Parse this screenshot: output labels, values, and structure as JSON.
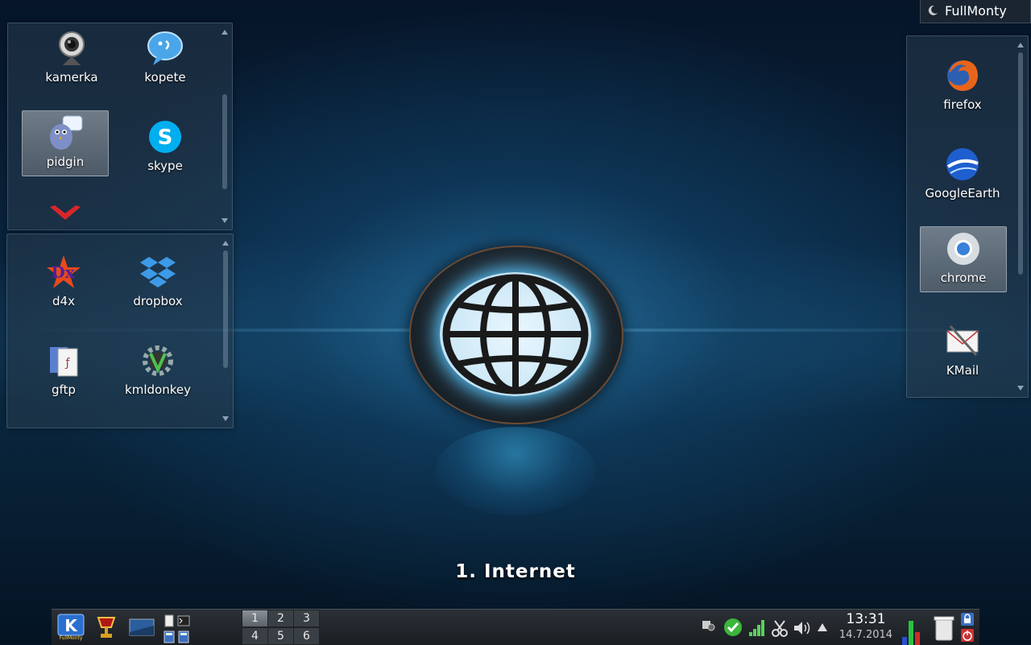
{
  "activity": {
    "name": "FullMonty"
  },
  "desktop": {
    "title": "1. Internet"
  },
  "folders": {
    "top_left": {
      "apps": [
        {
          "label": "kamerka",
          "icon": "webcam-icon"
        },
        {
          "label": "kopete",
          "icon": "kopete-icon"
        },
        {
          "label": "pidgin",
          "icon": "pidgin-icon",
          "selected": true
        },
        {
          "label": "skype",
          "icon": "skype-icon"
        }
      ]
    },
    "bottom_left": {
      "apps": [
        {
          "label": "d4x",
          "icon": "d4x-icon"
        },
        {
          "label": "dropbox",
          "icon": "dropbox-icon"
        },
        {
          "label": "gftp",
          "icon": "gftp-icon"
        },
        {
          "label": "kmldonkey",
          "icon": "kmldonkey-icon"
        }
      ]
    },
    "right": {
      "apps": [
        {
          "label": "firefox",
          "icon": "firefox-icon"
        },
        {
          "label": "GoogleEarth",
          "icon": "google-earth-icon"
        },
        {
          "label": "chrome",
          "icon": "chrome-icon",
          "selected": true
        },
        {
          "label": "KMail",
          "icon": "kmail-icon"
        }
      ]
    }
  },
  "taskbar": {
    "kmenu_label": "FullMonty",
    "pager": [
      "1",
      "2",
      "3",
      "4",
      "5",
      "6"
    ],
    "active_desktop": "1",
    "clock": {
      "time": "13:31",
      "date": "14.7.2014"
    }
  },
  "colors": {
    "accent": "#5ac8ff",
    "skype": "#00aff0",
    "dropbox": "#3d9ae8"
  }
}
